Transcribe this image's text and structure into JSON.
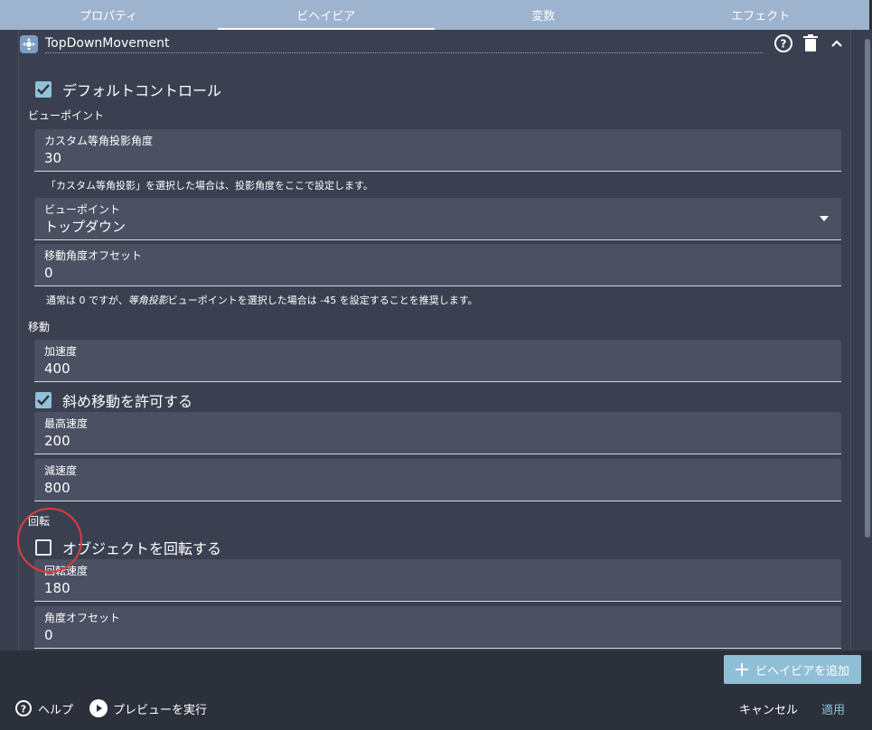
{
  "tabs": [
    {
      "label": "プロパティ"
    },
    {
      "label": "ビヘイビア"
    },
    {
      "label": "変数"
    },
    {
      "label": "エフェクト"
    }
  ],
  "behavior": {
    "name": "TopDownMovement"
  },
  "default_controls": {
    "label": "デフォルトコントロール",
    "checked": true
  },
  "viewpoint_section": {
    "label": "ビューポイント"
  },
  "custom_angle": {
    "label": "カスタム等角投影角度",
    "value": "30",
    "helper": "「カスタム等角投影」を選択した場合は、投影角度をここで設定します。"
  },
  "viewpoint": {
    "label": "ビューポイント",
    "value": "トップダウン"
  },
  "movement_offset": {
    "label": "移動角度オフセット",
    "value": "0",
    "helper_prefix": "通常は 0 ですが、",
    "helper_italic": "等角投影",
    "helper_suffix": "ビューポイントを選択した場合は -45 を設定することを推奨します。"
  },
  "movement_section": {
    "label": "移動"
  },
  "acceleration": {
    "label": "加速度",
    "value": "400"
  },
  "diagonal": {
    "label": "斜め移動を許可する",
    "checked": true
  },
  "max_speed": {
    "label": "最高速度",
    "value": "200"
  },
  "deceleration": {
    "label": "減速度",
    "value": "800"
  },
  "rotation_section": {
    "label": "回転"
  },
  "rotate_object": {
    "label": "オブジェクトを回転する",
    "checked": false
  },
  "rotation_speed": {
    "label": "回転速度",
    "value": "180"
  },
  "angle_offset": {
    "label": "角度オフセット",
    "value": "0"
  },
  "footer": {
    "add_behavior": "ビヘイビアを追加",
    "help": "ヘルプ",
    "preview": "プレビューを実行",
    "cancel": "キャンセル",
    "apply": "適用"
  },
  "colors": {
    "accent": "#8fc1d8",
    "tab_bar": "#9db3ce",
    "highlight_circle": "#e23a3a"
  }
}
